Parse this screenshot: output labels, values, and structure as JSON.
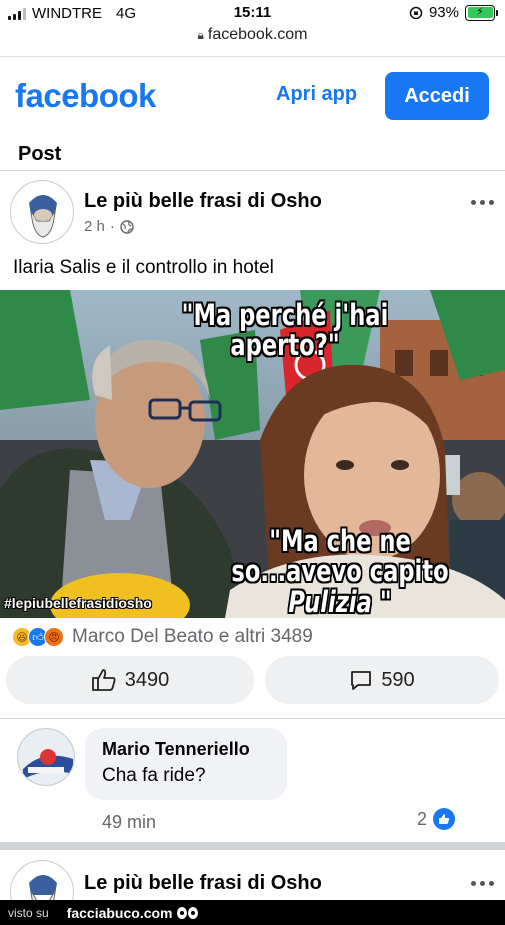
{
  "status_bar": {
    "carrier": "WINDTRE",
    "network": "4G",
    "time": "15:11",
    "battery": "93%",
    "battery_level": 0.93
  },
  "browser": {
    "url": "facebook.com",
    "lock_icon": "lock-icon"
  },
  "header": {
    "logo": "facebook",
    "open_app_label": "Apri app",
    "login_label": "Accedi",
    "brand_color": "#1877f2"
  },
  "section_title": "Post",
  "post": {
    "page_name": "Le più belle frasi di Osho",
    "time": "2 h",
    "audience_icon": "globe-icon",
    "caption": "Ilaria Salis e il controllo in hotel",
    "image": {
      "quote_top": "\"Ma perché j'hai aperto?\"",
      "quote_bottom_prefix": "\"Ma che ne so...avevo capito ",
      "quote_bottom_emph": "Pulizia",
      "quote_bottom_suffix": " \"",
      "hashtag": "#lepiubellefrasidiosho"
    },
    "reactions_text": "Marco Del Beato e altri 3489",
    "reaction_icons": [
      "haha-icon",
      "like-icon",
      "angry-icon"
    ],
    "like_count": "3490",
    "comment_count": "590"
  },
  "comment": {
    "author": "Mario Tenneriello",
    "text": "Cha fa ride?",
    "time": "49 min",
    "likes": "2"
  },
  "next_post": {
    "page_name": "Le più belle frasi di Osho"
  },
  "footer": {
    "visto": "visto su",
    "brand": "facciabuco.com"
  }
}
